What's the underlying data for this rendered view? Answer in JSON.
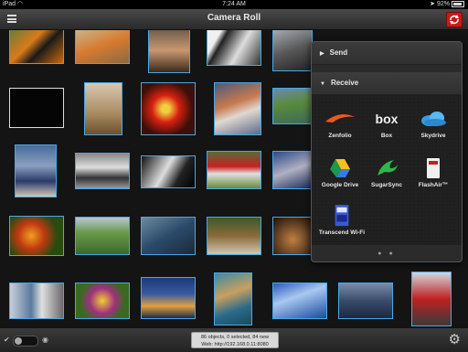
{
  "status_bar": {
    "device": "iPad",
    "time": "7:24 AM",
    "battery": "92%"
  },
  "header": {
    "title": "Camera Roll"
  },
  "popover": {
    "send_label": "Send",
    "receive_label": "Receive",
    "services": [
      {
        "label": "Zenfolio",
        "icon": "zenfolio-icon"
      },
      {
        "label": "Box",
        "icon": "box-icon"
      },
      {
        "label": "Skydrive",
        "icon": "skydrive-icon"
      },
      {
        "label": "Google Drive",
        "icon": "google-drive-icon"
      },
      {
        "label": "SugarSync",
        "icon": "sugarsync-icon"
      },
      {
        "label": "FlashAir™",
        "icon": "flashair-icon"
      },
      {
        "label": "Transcend Wi-Fi",
        "icon": "transcend-wifi-icon"
      }
    ],
    "page_count": 2,
    "current_page": 1
  },
  "footer": {
    "info_line1": "86 objects, 0 selected, 84 new",
    "info_line2": "Web: http://192.168.0.11:8080"
  },
  "colors": {
    "selection_border": "#4aa8e6",
    "sync_button": "#c81818"
  }
}
